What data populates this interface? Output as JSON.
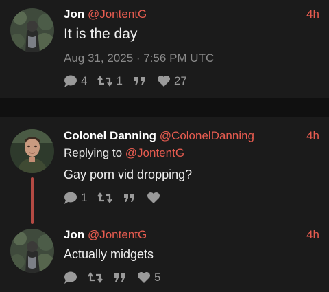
{
  "posts": [
    {
      "author": "Jon",
      "handle": "@JontentG",
      "time": "4h",
      "text": "It is the day",
      "timestamp": "Aug 31, 2025 · 7:56 PM UTC",
      "stats": {
        "replies": "4",
        "retweets": "1",
        "quotes": "",
        "likes": "27"
      }
    },
    {
      "author": "Colonel Danning",
      "handle": "@ColonelDanning",
      "time": "4h",
      "replying_prefix": "Replying to",
      "replying_to": "@JontentG",
      "text": "Gay porn vid dropping?",
      "stats": {
        "replies": "1",
        "retweets": "",
        "quotes": "",
        "likes": ""
      }
    },
    {
      "author": "Jon",
      "handle": "@JontentG",
      "time": "4h",
      "text": "Actually midgets",
      "stats": {
        "replies": "",
        "retweets": "",
        "quotes": "",
        "likes": "5"
      }
    }
  ],
  "icons": {
    "reply": "speech-bubble-icon",
    "retweet": "retweet-icon",
    "quote": "quote-icon",
    "like": "heart-icon"
  },
  "colors": {
    "accent": "#e85c50",
    "background": "#1b1b1b",
    "muted": "#9a9a9a"
  }
}
